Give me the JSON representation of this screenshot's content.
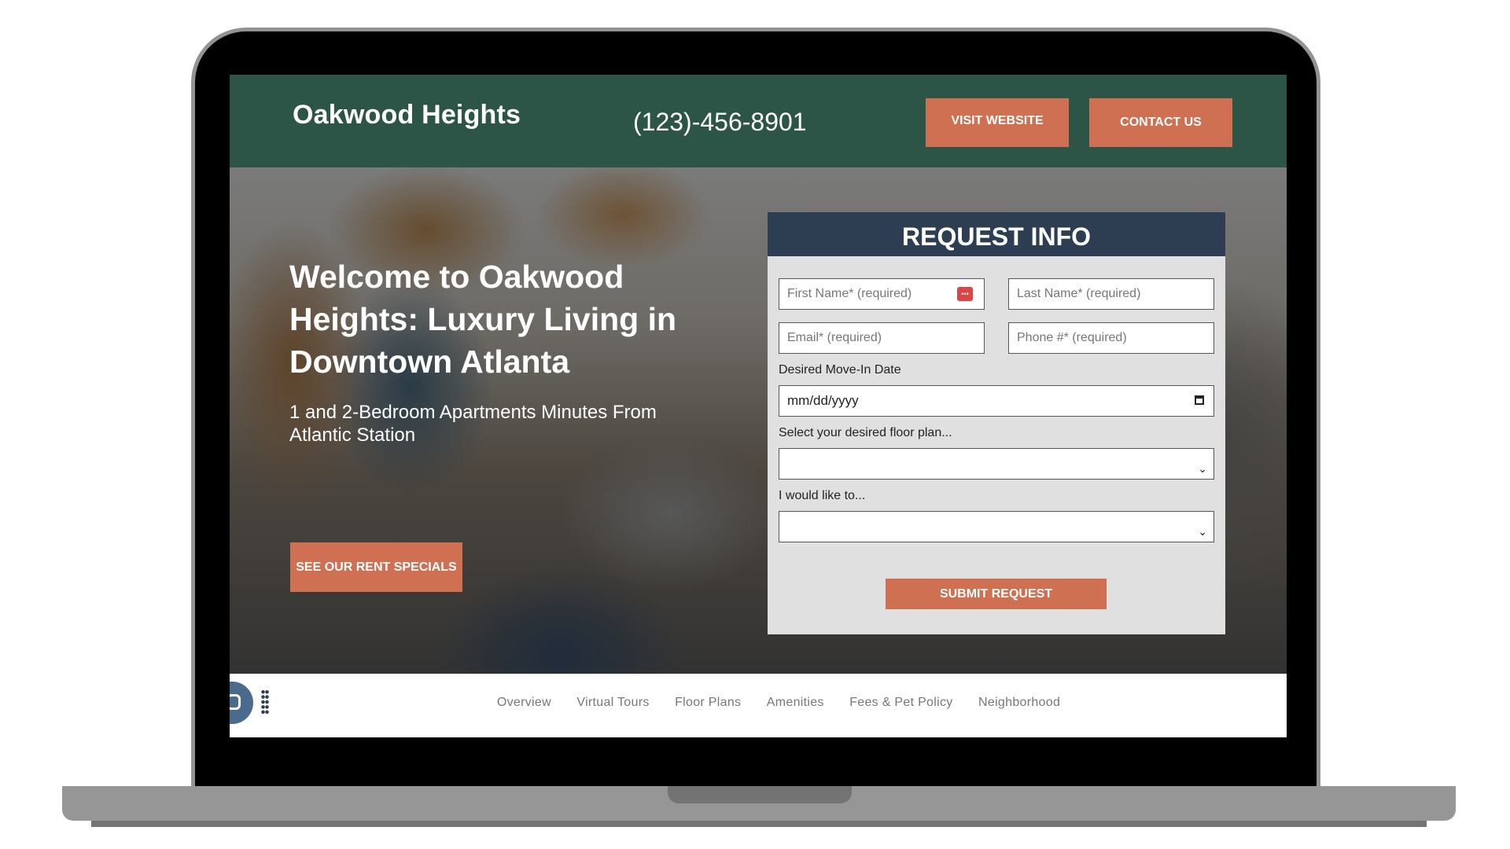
{
  "header": {
    "brand": "Oakwood Heights",
    "phone": "(123)-456-8901",
    "visit_label": "VISIT WEBSITE",
    "contact_label": "CONTACT US"
  },
  "hero": {
    "title": "Welcome to Oakwood Heights: Luxury Living in Downtown Atlanta",
    "subtitle": "1 and 2-Bedroom Apartments Minutes From Atlantic Station",
    "cta_label": "SEE OUR RENT SPECIALS"
  },
  "form": {
    "title": "REQUEST INFO",
    "first_name_placeholder": "First Name* (required)",
    "last_name_placeholder": "Last Name* (required)",
    "email_placeholder": "Email* (required)",
    "phone_placeholder": "Phone #* (required)",
    "move_in_label": "Desired Move-In Date",
    "move_in_value": "mm/dd/yyyy",
    "floor_plan_label": "Select your desired floor plan...",
    "floor_plan_value": "",
    "intent_label": "I would like to...",
    "intent_value": "",
    "submit_label": "SUBMIT REQUEST",
    "autofill_icon": "password-manager-icon"
  },
  "nav": {
    "items": [
      {
        "label": "Overview"
      },
      {
        "label": "Virtual Tours"
      },
      {
        "label": "Floor Plans"
      },
      {
        "label": "Amenities"
      },
      {
        "label": "Fees & Pet Policy"
      },
      {
        "label": "Neighborhood"
      }
    ]
  },
  "colors": {
    "header_bg": "#2c5548",
    "accent": "#d07053",
    "form_header_bg": "#2d3e52",
    "form_bg": "#e0e0e0"
  }
}
